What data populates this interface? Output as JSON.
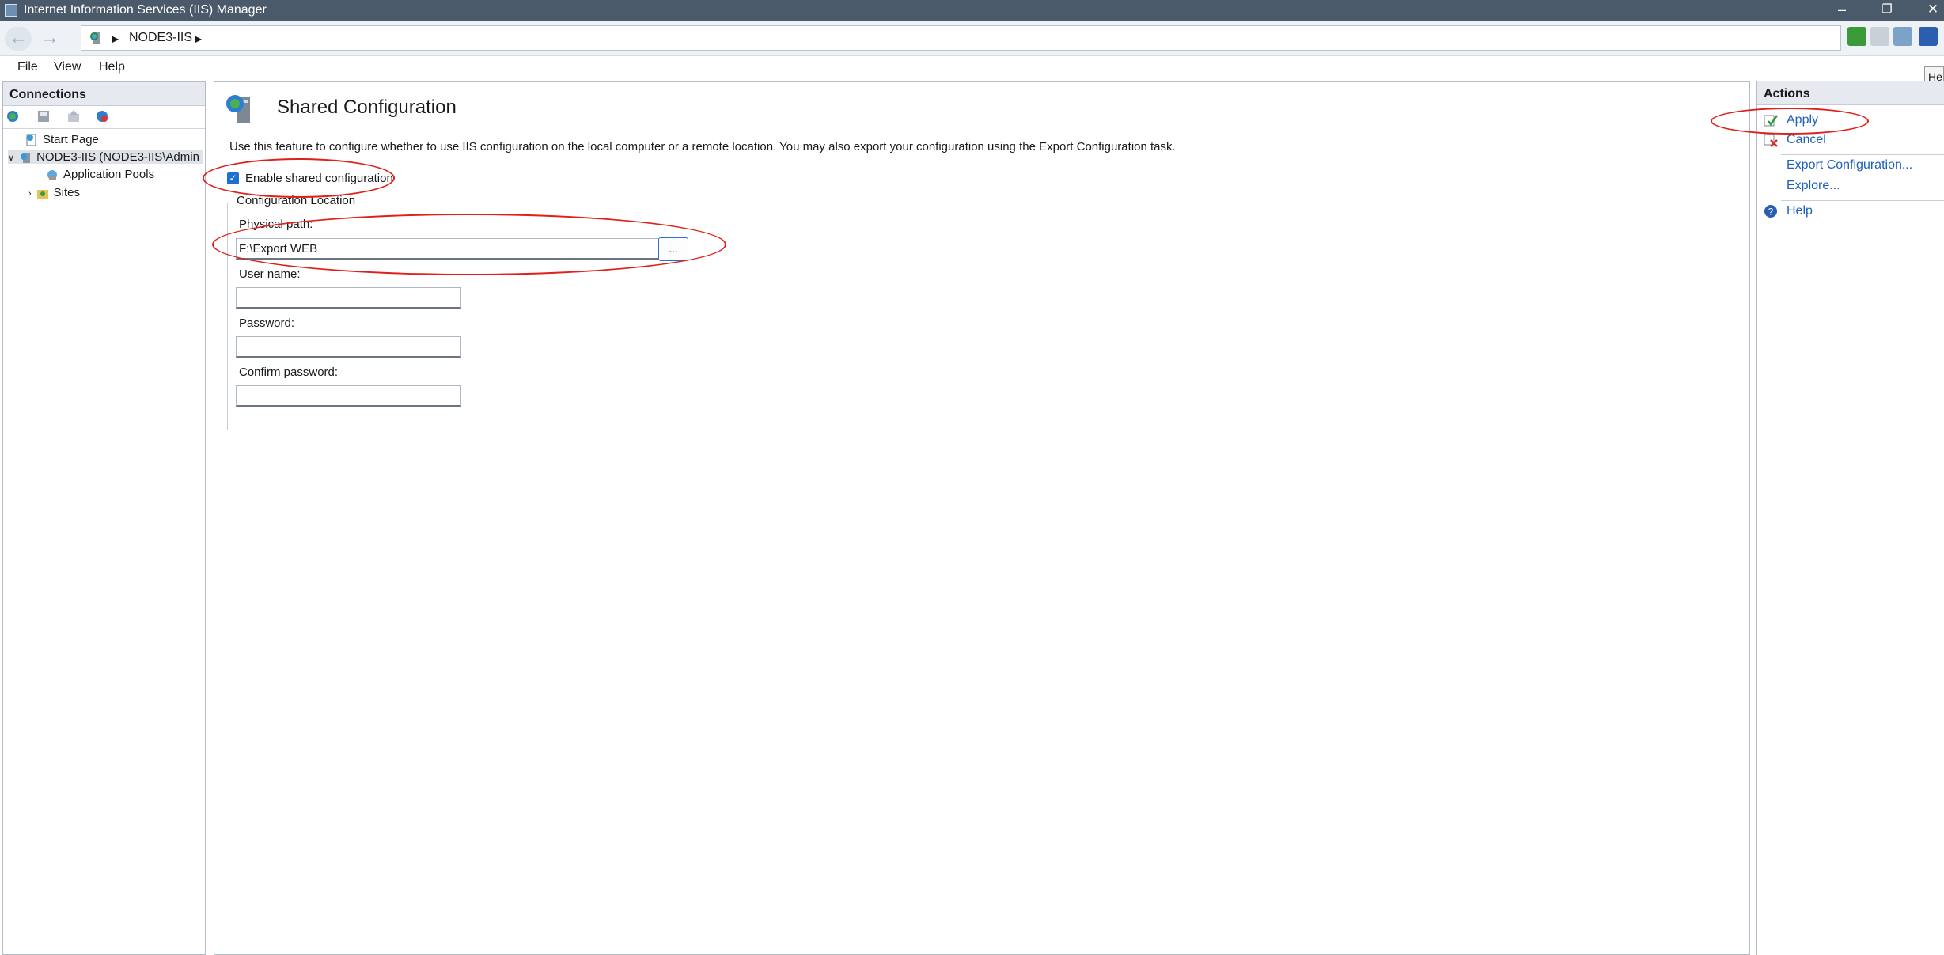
{
  "window": {
    "title": "Internet Information Services (IIS) Manager",
    "min": "–",
    "restore": "❐",
    "close": "✕"
  },
  "nav": {
    "back": "←",
    "forward": "→",
    "crumb": "NODE3-IIS"
  },
  "menu": [
    "File",
    "View",
    "Help"
  ],
  "connections": {
    "title": "Connections",
    "tree": [
      "Start Page",
      "NODE3-IIS (NODE3-IIS\\Admin",
      "Application Pools",
      "Sites"
    ]
  },
  "feature": {
    "title": "Shared Configuration",
    "description": "Use this feature to configure whether to use IIS configuration on the local computer or a remote location. You may also export your configuration using the Export Configuration task.",
    "enable_label": "Enable shared configuration",
    "enable_checked": true,
    "group_label": "Configuration Location",
    "physical_path_label": "Physical path:",
    "physical_path_value": "F:\\Export WEB",
    "browse_label": "...",
    "username_label": "User name:",
    "username_value": "",
    "password_label": "Password:",
    "password_value": "",
    "confirm_label": "Confirm password:",
    "confirm_value": ""
  },
  "actions": {
    "title": "Actions",
    "apply": "Apply",
    "cancel": "Cancel",
    "export": "Export Configuration...",
    "explore": "Explore...",
    "help": "Help"
  },
  "tooltip": "He",
  "colors": {
    "annotation": "#e0201a",
    "link": "#1f5fbf",
    "titlebar": "#4b5a6a"
  }
}
